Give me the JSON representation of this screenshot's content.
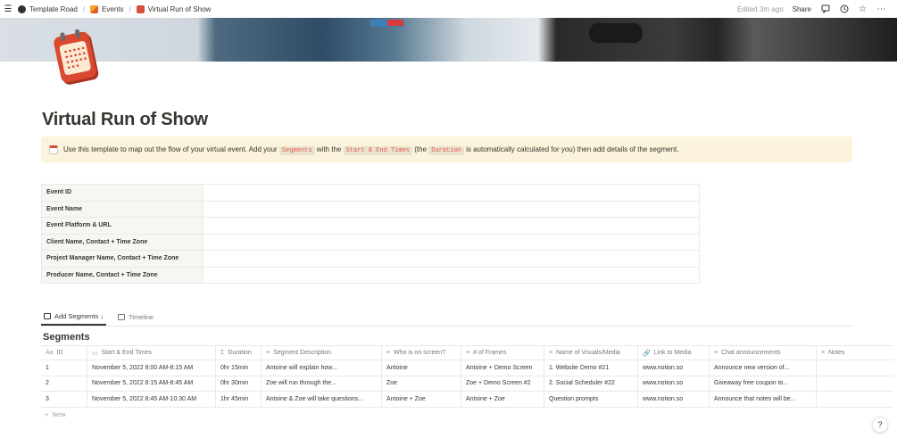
{
  "breadcrumb": [
    {
      "label": "Template Road",
      "icon": "road-logo-icon"
    },
    {
      "label": "Events",
      "icon": "events-icon"
    },
    {
      "label": "Virtual Run of Show",
      "icon": "calendar-icon"
    }
  ],
  "topbar": {
    "edited": "Edited 3m ago",
    "share": "Share"
  },
  "page": {
    "title": "Virtual Run of Show"
  },
  "callout": {
    "t1": "Use this template to map out the flow of your virtual event. Add your",
    "c1": "Segments",
    "t2": "with the",
    "c2": "Start & End Times",
    "t3": "(the",
    "c3": "Duration",
    "t4": "is automatically calculated for you) then add details of the segment."
  },
  "info_rows": [
    "Event ID",
    "Event Name",
    "Event Platform & URL",
    "Client Name, Contact + Time Zone",
    "Project Manager Name, Contact + Time Zone",
    "Producer Name, Contact + Time Zone"
  ],
  "tabs": [
    {
      "label": "Add Segments ↓",
      "active": true
    },
    {
      "label": "Timeline",
      "active": false
    }
  ],
  "segments": {
    "title": "Segments",
    "columns": [
      {
        "icon": "Aa",
        "label": "ID"
      },
      {
        "icon": "▭",
        "label": "Start & End Times"
      },
      {
        "icon": "Σ",
        "label": "Duration"
      },
      {
        "icon": "≡",
        "label": "Segment Description"
      },
      {
        "icon": "≡",
        "label": "Who is on screen?"
      },
      {
        "icon": "≡",
        "label": "# of Frames"
      },
      {
        "icon": "≡",
        "label": "Name of Visuals/Media"
      },
      {
        "icon": "🔗",
        "label": "Link to Media"
      },
      {
        "icon": "≡",
        "label": "Chat announcements"
      },
      {
        "icon": "≡",
        "label": "Notes"
      }
    ],
    "rows": [
      [
        "1",
        "November 5, 2022 8:00 AM-8:15 AM",
        "0hr 15min",
        "Antoine will explain how...",
        "Antoine",
        "Antoine + Demo Screen",
        "1. Website Demo #21",
        "www.notion.so",
        "Announce new version of...",
        ""
      ],
      [
        "2",
        "November 5, 2022 8:15 AM-8:45 AM",
        "0hr 30min",
        "Zoe will run through the...",
        "Zoe",
        "Zoe + Demo Screen #2",
        "2. Social Scheduler #22",
        "www.notion.so",
        "Giveaway free coupon to...",
        ""
      ],
      [
        "3",
        "November 5, 2022 8:45 AM-10:30 AM",
        "1hr 45min",
        "Antoine & Zoe will take questions...",
        "Antoine + Zoe",
        "Antoine + Zoe",
        "Question prompts",
        "www.notion.so",
        "Announce that notes will be...",
        ""
      ]
    ],
    "new_label": "New"
  },
  "help": "?"
}
